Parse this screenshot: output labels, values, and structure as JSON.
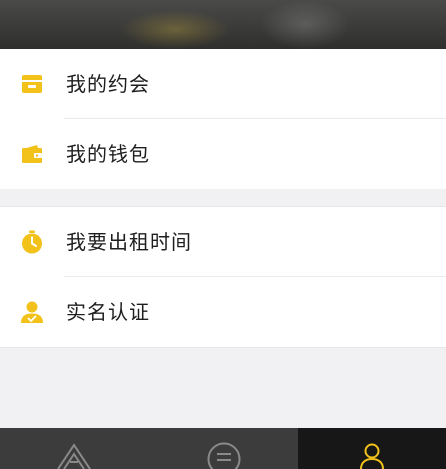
{
  "menu": {
    "group1": [
      {
        "label": "我的约会",
        "icon": "date-card-icon"
      },
      {
        "label": "我的钱包",
        "icon": "wallet-icon"
      }
    ],
    "group2": [
      {
        "label": "我要出租时间",
        "icon": "stopwatch-icon"
      },
      {
        "label": "实名认证",
        "icon": "verified-user-icon"
      }
    ]
  },
  "tabbar": {
    "tabs": [
      {
        "icon": "home-logo-icon"
      },
      {
        "icon": "messages-icon"
      },
      {
        "icon": "profile-icon",
        "active": true
      }
    ]
  },
  "colors": {
    "accent": "#f2c21a",
    "tabbar_bg": "#3c3c3c",
    "tab_active_bg": "#171717"
  }
}
